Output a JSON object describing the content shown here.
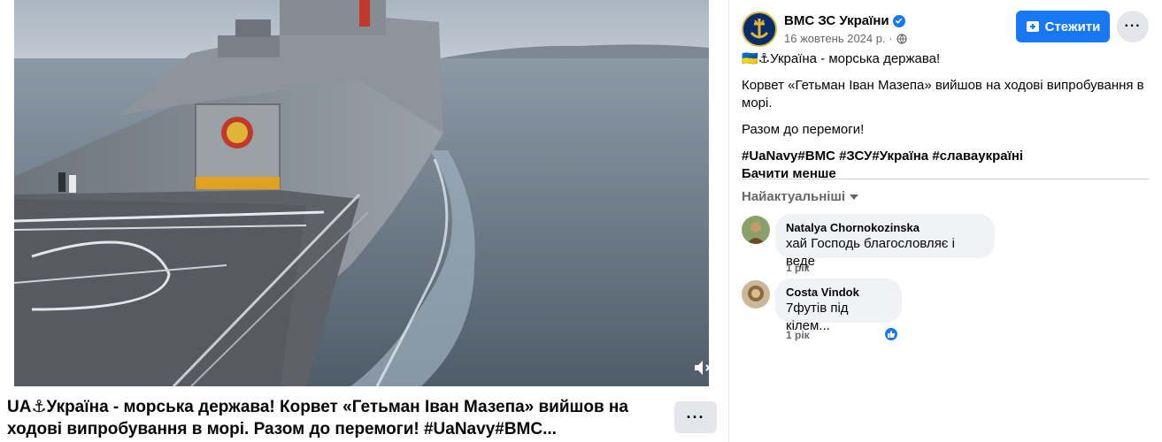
{
  "video": {
    "caption": "UA⚓Україна - морська держава! Корвет «Гетьман Іван Мазепа» вийшов на ходові випробування в морі. Разом до перемоги! #UaNavy#ВМС...",
    "more_label": "···"
  },
  "post": {
    "page_name": "ВМС ЗС України",
    "date": "16 жовтень 2024 р. ·",
    "follow_label": "Стежити",
    "more_label": "···",
    "line1": "🇺🇦⚓Україна - морська держава!",
    "line2": "Корвет «Гетьман Іван Мазепа» вийшов на ходові випробування в морі.",
    "line3": "Разом до перемоги!",
    "hashtags": [
      "#UaNavy",
      "#ВМС",
      " #ЗСУ",
      "#Україна",
      " #славаукраїні"
    ],
    "see_less": "Бачити менше"
  },
  "comments": {
    "sort_label": "Найактуальніші",
    "items": [
      {
        "author": "Natalya Chornokozinska",
        "text": "хай Господь благословляє і веде",
        "time": "1 рік"
      },
      {
        "author": "Costa Vindok",
        "text": "7футів під кілем...",
        "time": "1 рік"
      }
    ]
  },
  "colors": {
    "accent": "#1877f2",
    "secondary_text": "#65676b",
    "bubble": "#f0f2f5"
  }
}
